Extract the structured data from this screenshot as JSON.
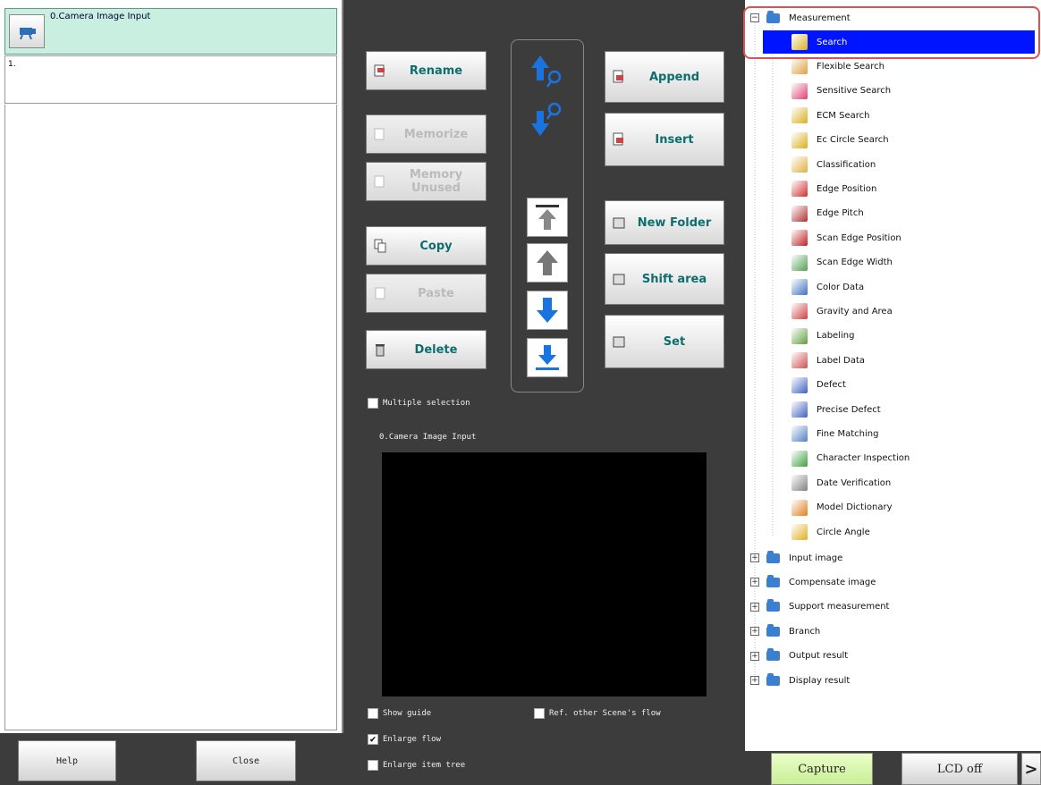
{
  "flow": {
    "row0_label": "0.Camera Image Input",
    "row1_label": "1."
  },
  "footer": {
    "help": "Help",
    "close": "Close"
  },
  "edit_buttons": {
    "rename": "Rename",
    "memorize": "Memorize",
    "memorize_unnamed": "Memory Unused",
    "copy": "Copy",
    "paste": "Paste",
    "delete": "Delete",
    "append": "Append",
    "insert": "Insert",
    "new_folder": "New Folder",
    "shift_area": "Shift area",
    "set": "Set"
  },
  "options": {
    "multiple_selection": "Multiple selection",
    "show_guide": "Show guide",
    "ref_other": "Ref. other Scene's flow",
    "enlarge_flow": "Enlarge flow",
    "enlarge_item_tree": "Enlarge item tree",
    "multiple_selection_checked": false,
    "show_guide_checked": false,
    "ref_other_checked": false,
    "enlarge_flow_checked": true,
    "enlarge_item_tree_checked": false
  },
  "preview": {
    "label": "0.Camera Image Input"
  },
  "tree": {
    "root": "Measurement",
    "items": [
      {
        "label": "Search",
        "icon": "search-icon",
        "color": "#d8b020",
        "selected": true
      },
      {
        "label": "Flexible Search",
        "icon": "flexible-search-icon",
        "color": "#e0a040"
      },
      {
        "label": "Sensitive Search",
        "icon": "sensitive-search-icon",
        "color": "#e04070"
      },
      {
        "label": "ECM Search",
        "icon": "ecm-search-icon",
        "color": "#d8b020"
      },
      {
        "label": "Ec Circle Search",
        "icon": "ec-circle-search-icon",
        "color": "#d8b020"
      },
      {
        "label": "Classification",
        "icon": "classification-icon",
        "color": "#e0b040"
      },
      {
        "label": "Edge Position",
        "icon": "edge-position-icon",
        "color": "#d03030"
      },
      {
        "label": "Edge Pitch",
        "icon": "edge-pitch-icon",
        "color": "#b03030"
      },
      {
        "label": "Scan Edge Position",
        "icon": "scan-edge-position-icon",
        "color": "#c02020"
      },
      {
        "label": "Scan Edge Width",
        "icon": "scan-edge-width-icon",
        "color": "#50a050"
      },
      {
        "label": "Color Data",
        "icon": "color-data-icon",
        "color": "#4070c0"
      },
      {
        "label": "Gravity and Area",
        "icon": "gravity-area-icon",
        "color": "#d04040"
      },
      {
        "label": "Labeling",
        "icon": "labeling-icon",
        "color": "#60a040"
      },
      {
        "label": "Label Data",
        "icon": "label-data-icon",
        "color": "#d05050"
      },
      {
        "label": "Defect",
        "icon": "defect-icon",
        "color": "#4060c0"
      },
      {
        "label": "Precise Defect",
        "icon": "precise-defect-icon",
        "color": "#4060c0"
      },
      {
        "label": "Fine Matching",
        "icon": "fine-matching-icon",
        "color": "#5080c0"
      },
      {
        "label": "Character Inspection",
        "icon": "character-inspection-icon",
        "color": "#40a040"
      },
      {
        "label": "Date Verification",
        "icon": "date-verification-icon",
        "color": "#808080"
      },
      {
        "label": "Model Dictionary",
        "icon": "model-dictionary-icon",
        "color": "#e08020"
      },
      {
        "label": "Circle Angle",
        "icon": "circle-angle-icon",
        "color": "#e0b020"
      }
    ],
    "folders": [
      "Input image",
      "Compensate image",
      "Support measurement",
      "Branch",
      "Output result",
      "Display result"
    ]
  },
  "bottom": {
    "capture": "Capture",
    "lcd_off": "LCD off",
    "more": ">"
  }
}
